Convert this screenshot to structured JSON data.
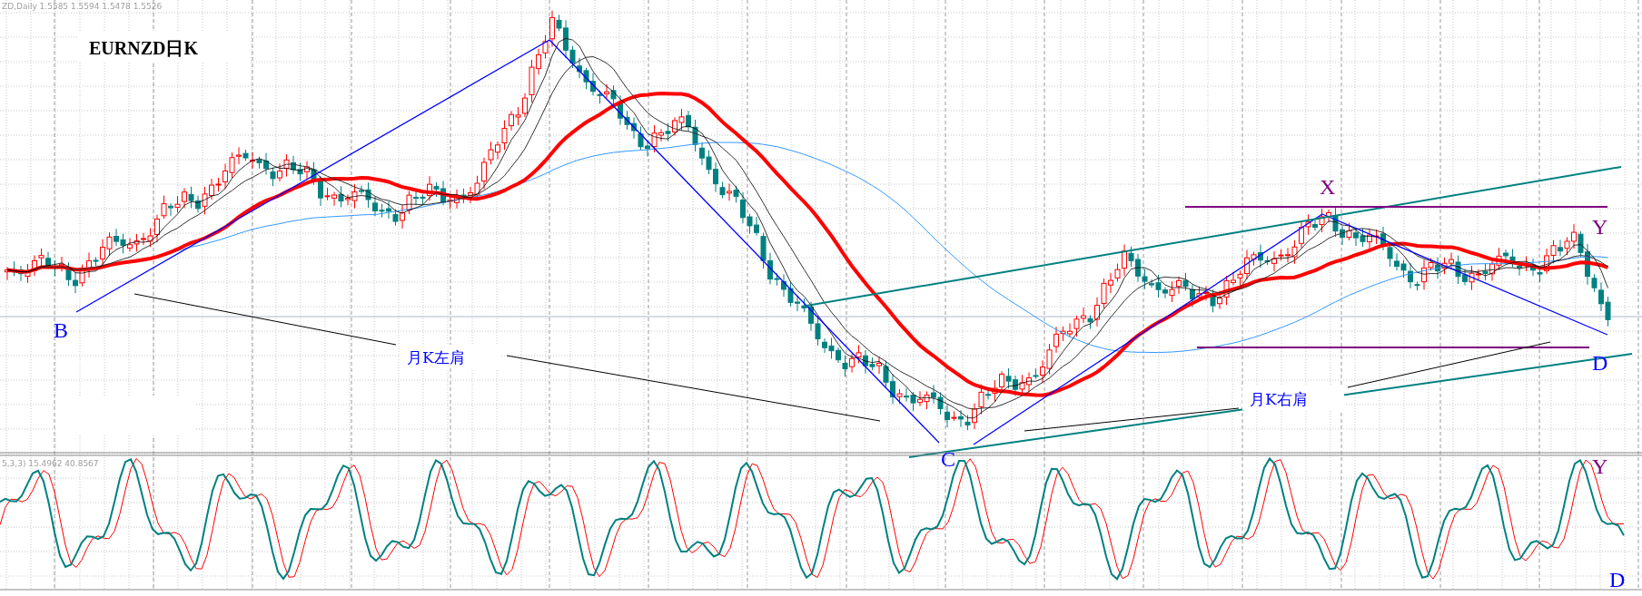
{
  "chart": {
    "info": "ZD,Daily  1.5585 1.5594 1.5478 1.5526",
    "title": "EURNZD日K",
    "point_labels": {
      "b": "B",
      "c": "C",
      "x": "X",
      "y": "Y",
      "d": "D"
    },
    "shoulder_labels": [
      "月K左肩",
      "月K右肩"
    ]
  },
  "indicator": {
    "info": "5,3,3) 15.4962 40.8567",
    "point_labels": {
      "y": "Y",
      "d": "D"
    }
  }
}
